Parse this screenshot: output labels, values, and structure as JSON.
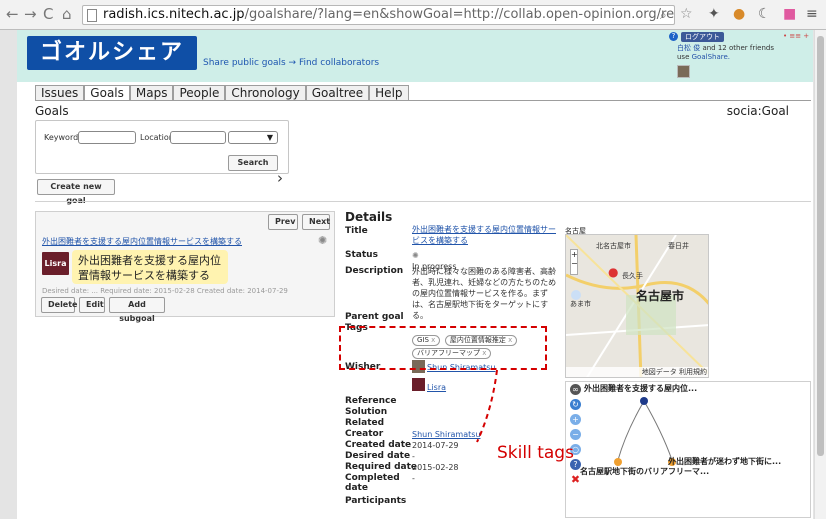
{
  "browser": {
    "url_host": "radish.ics.nitech.ac.jp",
    "url_rest": "/goalshare/?lang=en&showGoal=http://collab.open-opinion.org/resource/Gc"
  },
  "header": {
    "logo": "ゴオルシェア",
    "tagline": "Share public goals → Find collaborators",
    "login_label": "ログアウト",
    "lang": "• ≡≡ +",
    "friends_name": "白松 俊",
    "friends_line1": " and 12 other friends",
    "friends_line2": "use ",
    "friends_app": "GoalShare."
  },
  "tabs": [
    "Issues",
    "Goals",
    "Maps",
    "People",
    "Chronology",
    "Goaltree",
    "Help"
  ],
  "page": {
    "title": "Goals",
    "namespace": "socia:Goal"
  },
  "search": {
    "keyword_label": "Keyword",
    "location_label": "Location",
    "search_button": "Search",
    "create_button": "Create new goal"
  },
  "list": {
    "prev": "Prev",
    "next": "Next",
    "top_link": "外出困難者を支援する屋内位置情報サービスを構築する",
    "card_icon": "Lisra",
    "card_text": "外出困難者を支援する屋内位置情報サービスを構築する",
    "dates": "Desired date: ...   Required date: 2015-02-28   Created date: 2014-07-29",
    "delete": "Delete",
    "edit": "Edit",
    "add_subgoal": "Add subgoal"
  },
  "details": {
    "heading": "Details",
    "labels": {
      "title": "Title",
      "status": "Status",
      "description": "Description",
      "parent": "Parent goal",
      "tags": "Tags",
      "wisher": "Wisher",
      "reference": "Reference",
      "solution": "Solution",
      "related": "Related",
      "creator": "Creator",
      "created": "Created date",
      "desired": "Desired date",
      "required": "Required date",
      "completed": "Completed date",
      "participants": "Participants"
    },
    "title_value": "外出困難者を支援する屋内位置情報サービスを構築する",
    "status_value": "In progress",
    "description_value": "外出時に様々な困難のある障害者、高齢者、乳児連れ、妊婦などの方たちのための屋内位置情報サービスを作る。まずは、名古屋駅地下街をターゲットにする。",
    "tags": [
      "GIS",
      "屋内位置情報推定",
      "バリアフリーマップ"
    ],
    "wisher1": "Shun Shiramatsu",
    "wisher2": "Lisra",
    "creator_value": "Shun Shiramatsu",
    "created_value": "2014-07-29",
    "desired_value": "-",
    "required_value": "2015-02-28",
    "completed_value": "-"
  },
  "map": {
    "location": "名古屋",
    "city_big": "名古屋市",
    "label_kita": "北名古屋市",
    "label_kasugai": "春日井",
    "label_nagakute": "長久手",
    "label_ama": "あま市",
    "footer": "地図データ  利用規約"
  },
  "tree": {
    "root_label": "外出困難者を支援する屋内位...",
    "child_left": "名古屋駅地下街のバリアフリーマ...",
    "child_right": "外出困難者が迷わず地下街に..."
  },
  "annotation": {
    "text": "Skill tags",
    "color": "#d40000"
  },
  "colors": {
    "header_bg": "#cfeee8",
    "logo_bg": "#0f4fa6",
    "card_bg": "#fff3b0",
    "link": "#2255aa"
  }
}
